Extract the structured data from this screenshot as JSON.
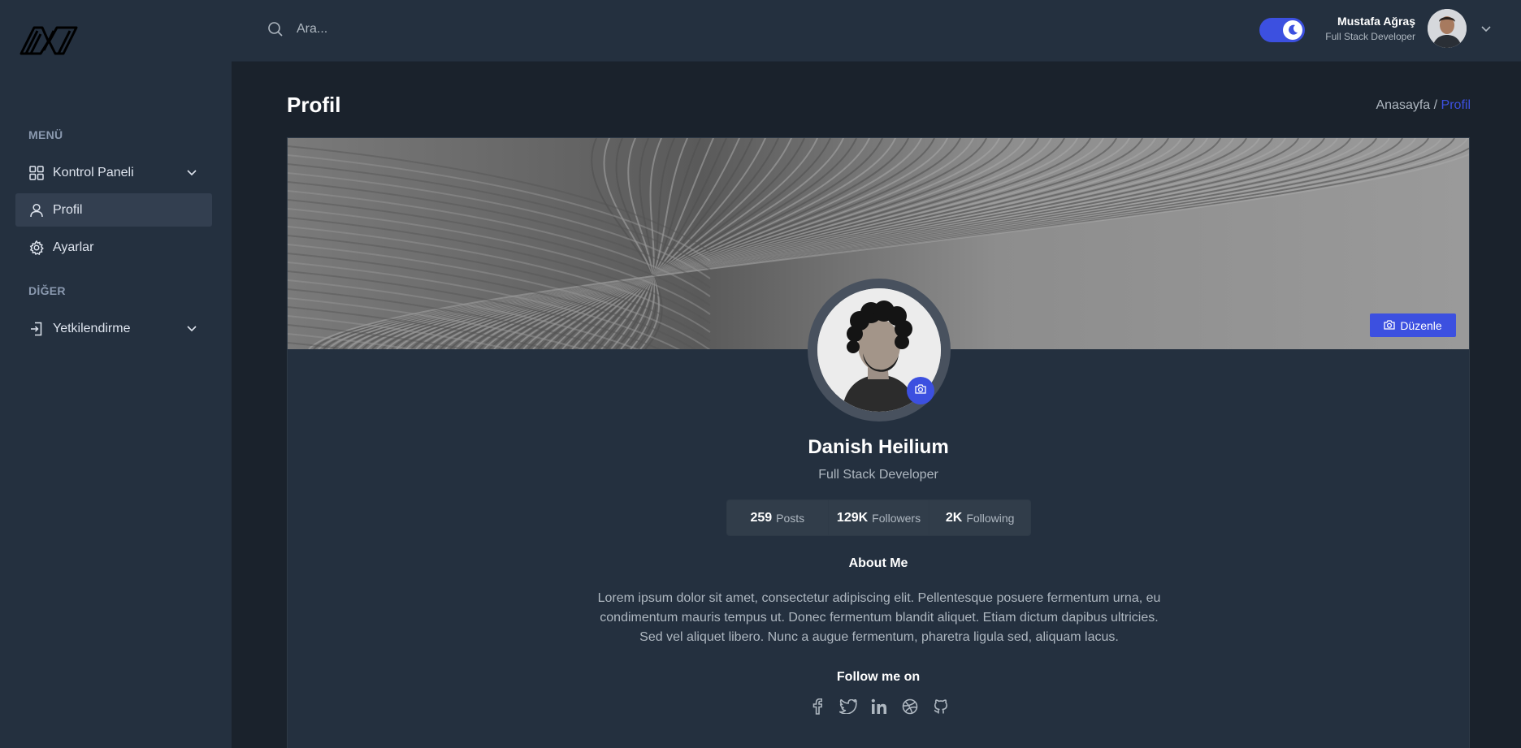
{
  "header": {
    "search_placeholder": "Ara...",
    "user_name": "Mustafa Ağraş",
    "user_role": "Full Stack Developer"
  },
  "sidebar": {
    "groups": [
      {
        "title": "MENÜ",
        "items": [
          {
            "label": "Kontrol Paneli",
            "icon": "dashboard-icon",
            "expandable": true
          },
          {
            "label": "Profil",
            "icon": "user-icon",
            "active": true
          },
          {
            "label": "Ayarlar",
            "icon": "gear-icon"
          }
        ]
      },
      {
        "title": "DİĞER",
        "items": [
          {
            "label": "Yetkilendirme",
            "icon": "login-icon",
            "expandable": true
          }
        ]
      }
    ]
  },
  "page": {
    "title": "Profil",
    "breadcrumb_home": "Anasayfa /",
    "breadcrumb_current": "Profil"
  },
  "profile": {
    "edit_cover_label": "Düzenle",
    "name": "Danish Heilium",
    "role": "Full Stack Developer",
    "stats": [
      {
        "value": "259",
        "label": "Posts"
      },
      {
        "value": "129K",
        "label": "Followers"
      },
      {
        "value": "2K",
        "label": "Following"
      }
    ],
    "about_title": "About Me",
    "about_text": "Lorem ipsum dolor sit amet, consectetur adipiscing elit. Pellentesque posuere fermentum urna, eu condimentum mauris tempus ut. Donec fermentum blandit aliquet. Etiam dictum dapibus ultricies. Sed vel aliquet libero. Nunc a augue fermentum, pharetra ligula sed, aliquam lacus.",
    "follow_title": "Follow me on",
    "socials": [
      "facebook-icon",
      "twitter-icon",
      "linkedin-icon",
      "dribbble-icon",
      "github-icon"
    ]
  },
  "colors": {
    "primary": "#3c50e0",
    "sidebar_bg": "#24303f",
    "body_bg": "#1a222c",
    "text_muted": "#aeb7c0"
  }
}
